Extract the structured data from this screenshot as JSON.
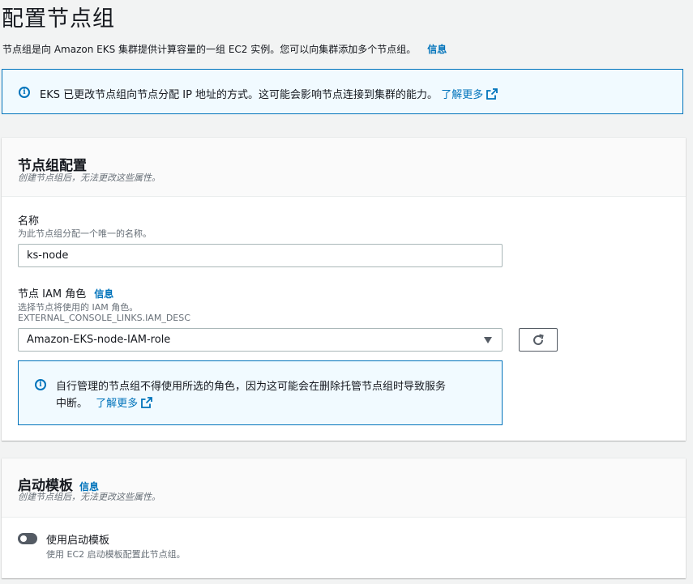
{
  "page": {
    "title": "配置节点组",
    "description": "节点组是向 Amazon EKS 集群提供计算容量的一组 EC2 实例。您可以向集群添加多个节点组。",
    "info_link": "信息"
  },
  "top_alert": {
    "text": "EKS 已更改节点组向节点分配 IP 地址的方式。这可能会影响节点连接到集群的能力。",
    "learn_more": "了解更多"
  },
  "nodegroup_panel": {
    "title": "节点组配置",
    "subtitle": "创建节点组后，无法更改这些属性。",
    "name_field": {
      "label": "名称",
      "help": "为此节点组分配一个唯一的名称。",
      "value": "ks-node"
    },
    "iam_field": {
      "label": "节点 IAM 角色",
      "info_link": "信息",
      "help": "选择节点将使用的 IAM 角色。",
      "help2": "EXTERNAL_CONSOLE_LINKS.IAM_DESC",
      "selected": "Amazon-EKS-node-IAM-role"
    },
    "alert": {
      "line1": "自行管理的节点组不得使用所选的角色，因为这可能会在删除托管节点组时导致服务",
      "line2": "中断。",
      "learn_more": "了解更多"
    }
  },
  "launch_template_panel": {
    "title": "启动模板",
    "info_link": "信息",
    "subtitle": "创建节点组后，无法更改这些属性。",
    "toggle": {
      "label": "使用启动模板",
      "help": "使用 EC2 启动模板配置此节点组。",
      "enabled": false
    }
  },
  "colors": {
    "accent": "#0073bb",
    "alert_bg": "#f1faff",
    "text": "#16191f",
    "muted": "#687078"
  }
}
